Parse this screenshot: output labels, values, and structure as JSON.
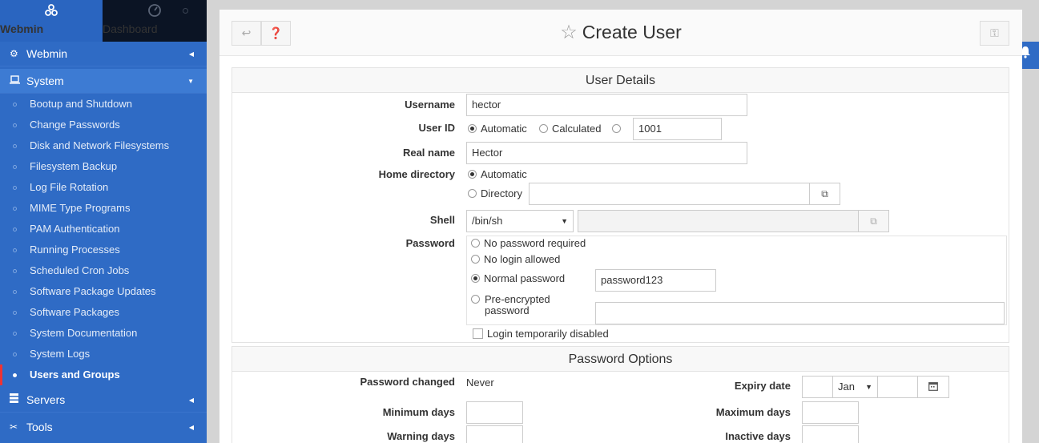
{
  "sidebar": {
    "brand": {
      "label": "Webmin",
      "icon": "webmin-logo-icon"
    },
    "dashboard": {
      "label": "Dashboard",
      "icon": "dashboard-icon"
    },
    "categories": [
      {
        "label": "Webmin",
        "icon": "gear-icon"
      },
      {
        "label": "System",
        "icon": "laptop-icon"
      },
      {
        "label": "Servers",
        "icon": "server-icon"
      },
      {
        "label": "Tools",
        "icon": "tools-icon"
      }
    ],
    "system_items": [
      {
        "label": "Bootup and Shutdown"
      },
      {
        "label": "Change Passwords"
      },
      {
        "label": "Disk and Network Filesystems"
      },
      {
        "label": "Filesystem Backup"
      },
      {
        "label": "Log File Rotation"
      },
      {
        "label": "MIME Type Programs"
      },
      {
        "label": "PAM Authentication"
      },
      {
        "label": "Running Processes"
      },
      {
        "label": "Scheduled Cron Jobs"
      },
      {
        "label": "Software Package Updates"
      },
      {
        "label": "Software Packages"
      },
      {
        "label": "System Documentation"
      },
      {
        "label": "System Logs"
      },
      {
        "label": "Users and Groups"
      }
    ],
    "active_item": "Users and Groups"
  },
  "header": {
    "title": "Create User"
  },
  "user_details": {
    "heading": "User Details",
    "username": {
      "label": "Username",
      "value": "hector"
    },
    "user_id": {
      "label": "User ID",
      "opt_automatic": "Automatic",
      "opt_calculated": "Calculated",
      "value": "1001",
      "selected": "Automatic"
    },
    "real_name": {
      "label": "Real name",
      "value": "Hector"
    },
    "home_directory": {
      "label": "Home directory",
      "opt_automatic": "Automatic",
      "opt_directory": "Directory",
      "value": "",
      "selected": "Automatic"
    },
    "shell": {
      "label": "Shell",
      "value": "/bin/sh"
    },
    "password": {
      "label": "Password",
      "opt_none": "No password required",
      "opt_nologin": "No login allowed",
      "opt_normal": "Normal password",
      "opt_preenc": "Pre-encrypted password",
      "normal_value": "password123",
      "selected": "Normal password",
      "disabled_label": "Login temporarily disabled"
    }
  },
  "password_options": {
    "heading": "Password Options",
    "password_changed": {
      "label": "Password changed",
      "value": "Never"
    },
    "expiry_date": {
      "label": "Expiry date",
      "month": "Jan"
    },
    "minimum_days": {
      "label": "Minimum days"
    },
    "maximum_days": {
      "label": "Maximum days"
    },
    "warning_days": {
      "label": "Warning days"
    },
    "inactive_days": {
      "label": "Inactive days"
    }
  },
  "colors": {
    "sidebar": "#2f6bc5",
    "sidebar_dark": "#0b1424",
    "accent_red": "#e33333"
  }
}
